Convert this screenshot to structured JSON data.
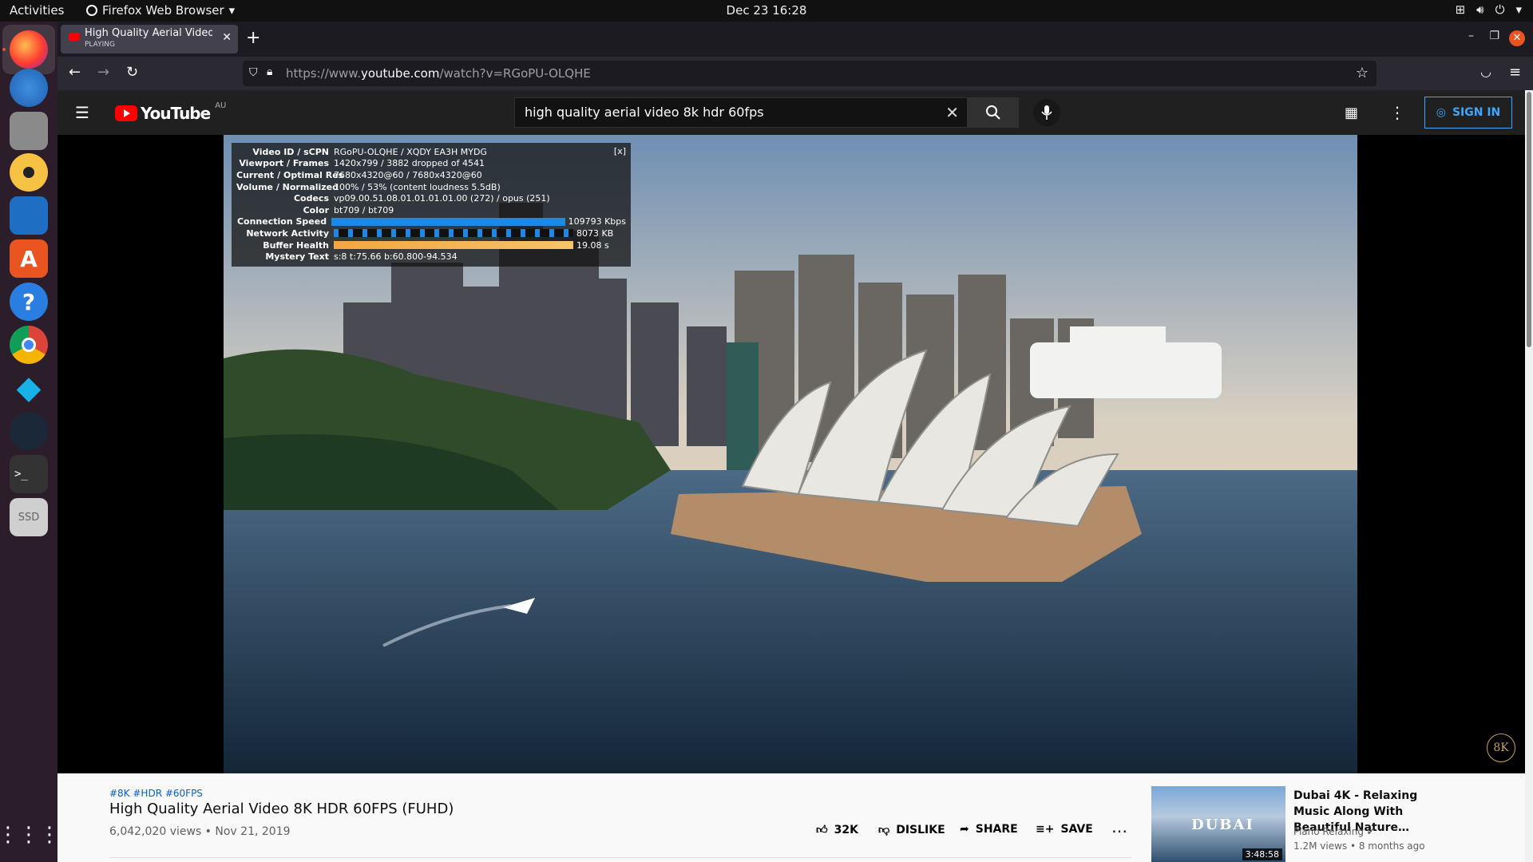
{
  "topbar": {
    "activities": "Activities",
    "app_name": "Firefox Web Browser",
    "clock": "Dec 23  16:28"
  },
  "dock": {
    "items": [
      "firefox",
      "thunderbird",
      "files",
      "rhythmbox",
      "libreoffice-writer",
      "app-center",
      "help",
      "chrome",
      "kodi",
      "steam",
      "terminal",
      "ssd",
      "show-apps"
    ],
    "ssd_label": "SSD"
  },
  "browser": {
    "tab_title": "High Quality Aerial Video",
    "tab_status": "PLAYING",
    "url_prefix": "https://www.",
    "url_domain": "youtube.com",
    "url_path": "/watch?v=RGoPU-OLQHE"
  },
  "youtube": {
    "logo_text": "YouTube",
    "country": "AU",
    "search_query": "high quality aerial video 8k hdr 60fps",
    "signin_label": "SIGN IN"
  },
  "stats": {
    "close": "[x]",
    "rows": [
      {
        "k": "Video ID / sCPN",
        "v": "RGoPU-OLQHE / XQDY EA3H MYDG"
      },
      {
        "k": "Viewport / Frames",
        "v": "1420x799 / 3882 dropped of 4541"
      },
      {
        "k": "Current / Optimal Res",
        "v": "7680x4320@60 / 7680x4320@60"
      },
      {
        "k": "Volume / Normalized",
        "v": "100% / 53% (content loudness 5.5dB)"
      },
      {
        "k": "Codecs",
        "v": "vp09.00.51.08.01.01.01.01.00 (272) / opus (251)"
      },
      {
        "k": "Color",
        "v": "bt709 / bt709"
      },
      {
        "k": "Connection Speed",
        "v": "109793 Kbps"
      },
      {
        "k": "Network Activity",
        "v": "8073 KB"
      },
      {
        "k": "Buffer Health",
        "v": "19.08 s"
      },
      {
        "k": "Mystery Text",
        "v": "s:8 t:75.66 b:60.800-94.534"
      }
    ]
  },
  "video": {
    "tags": "#8K #HDR #60FPS",
    "title": "High Quality Aerial Video 8K HDR 60FPS (FUHD)",
    "meta": "6,042,020 views • Nov 21, 2019",
    "likes": "32K",
    "dislike": "DISLIKE",
    "share": "SHARE",
    "save": "SAVE",
    "badge": "8K"
  },
  "recommended": {
    "title": "Dubai 4K - Relaxing Music Along With Beautiful Nature…",
    "channel": "Piano Relaxing",
    "views": "1.2M views • 8 months ago",
    "duration": "3:48:58",
    "thumb_text": "DUBAI"
  }
}
